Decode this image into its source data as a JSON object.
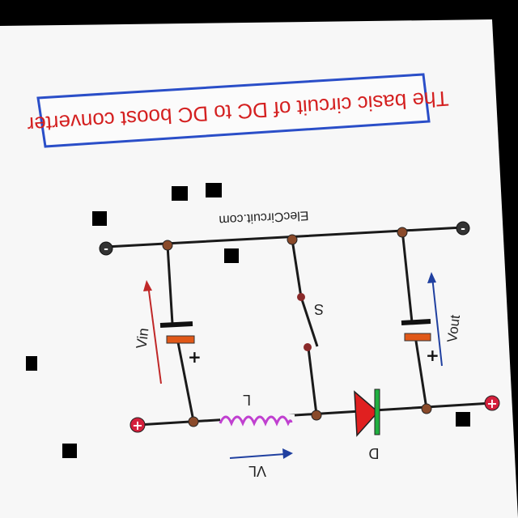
{
  "title": "The basic circuit of DC to DC boost converter",
  "website": "ElecCircuit.com",
  "labels": {
    "vin": "Vin",
    "vout": "Vout",
    "switch": "S",
    "inductor": "L",
    "diode": "D",
    "inductor_voltage": "VL",
    "terminal_plus": "+",
    "terminal_minus": "-",
    "battery_plus": "+"
  },
  "colors": {
    "background": "#000000",
    "paper": "#f7f7f7",
    "title_text": "#d42020",
    "title_border": "#2a4ec8",
    "wire": "#1a1a1a",
    "node": "#8a4a2a",
    "terminal": "#d4203c",
    "inductor": "#c040d0",
    "diode_body": "#e02020",
    "diode_bar": "#20b040",
    "battery_plate": "#e05818",
    "arrow_vin": "#c02828",
    "arrow_blue": "#2040a0"
  },
  "icons": [
    "battery-symbol",
    "inductor-coil",
    "diode-symbol",
    "switch-symbol",
    "terminal-plus-icon",
    "terminal-minus-icon"
  ]
}
